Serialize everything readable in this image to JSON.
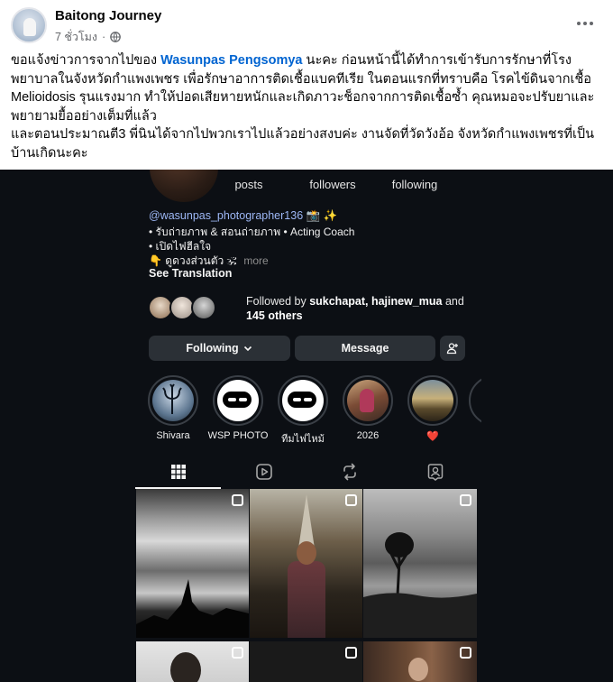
{
  "post": {
    "author": "Baitong Journey",
    "time": "7 ชั่วโมง",
    "separator": "·",
    "text_intro": "ขอแจ้งข่าวการจากไปของ ",
    "mention": "Wasunpas Pengsomya",
    "text_body": " นะคะ ก่อนหน้านี้ได้ทำการเข้ารับการรักษาที่โรงพยาบาลในจังหวัดกำแพงเพชร เพื่อรักษาอาการติดเชื้อแบคทีเรีย ในตอนแรกที่ทราบคือ โรคไข้ดินจากเชื้อ Melioidosis รุนแรงมาก ทำให้ปอดเสียหายหนักและเกิดภาวะช็อกจากการติดเชื้อซ้ำ คุณหมอจะปรับยาและพยายามยื้ออย่างเต็มที่แล้ว",
    "text_second": "และตอนประมาณตี3 พี่นินได้จากไปพวกเราไปแล้วอย่างสงบค่ะ งานจัดที่วัดวังอ้อ จังหวัดกำแพงเพชรที่เป็นบ้านเกิดนะคะ"
  },
  "profile": {
    "stats": [
      {
        "label": "posts"
      },
      {
        "label": "followers"
      },
      {
        "label": "following"
      }
    ],
    "handle": "@wasunpas_photographer136 📸 ✨",
    "bio_lines": [
      "• รับถ่ายภาพ & สอนถ่ายภาพ • Acting Coach",
      "• เปิดไฟฮีลใจ",
      "👇 ดูดวงส่วนตัว 🕉"
    ],
    "bio_more": "more",
    "see_translation": "See Translation",
    "followed_prefix": "Followed by ",
    "followed_names": "sukchapat, hajinew_mua",
    "followed_and": " and ",
    "followed_count": "145 others",
    "buttons": {
      "following": "Following",
      "message": "Message"
    },
    "highlights": [
      {
        "label": "Shivara"
      },
      {
        "label": "WSP PHOTO"
      },
      {
        "label": "ทีมไฟไหม้"
      },
      {
        "label": "2026"
      },
      {
        "label": "❤️"
      }
    ]
  },
  "colors": {
    "mention": "#0064d1",
    "ig_bg": "#0c0f14",
    "button": "#2b3036"
  },
  "icons": [
    "globe-icon",
    "more-horizontal-icon",
    "chevron-down-icon",
    "add-user-icon",
    "grid-icon",
    "reels-icon",
    "reposts-icon",
    "tagged-icon",
    "multi-image-icon"
  ]
}
